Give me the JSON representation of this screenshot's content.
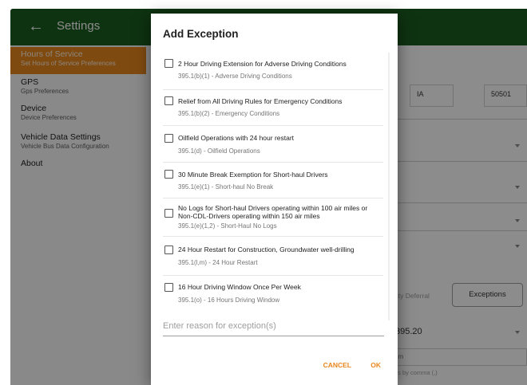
{
  "appbar": {
    "back_icon": "arrow-left-icon",
    "title": "Settings"
  },
  "sidebar": {
    "items": [
      {
        "title": "Hours of Service",
        "subtitle": "Set Hours of Service Preferences",
        "active": true
      },
      {
        "title": "GPS",
        "subtitle": "Gps Preferences",
        "active": false
      },
      {
        "title": "Device",
        "subtitle": "Device Preferences",
        "active": false
      },
      {
        "title": "Vehicle Data Settings",
        "subtitle": "Vehicle Bus Data Configuration",
        "active": false
      },
      {
        "title": "About",
        "subtitle": "",
        "active": false
      }
    ]
  },
  "main": {
    "state": "IA",
    "zip": "50501",
    "deferral_label": "uty Deferral",
    "exceptions_button": "Exceptions",
    "rule_value": "395.20",
    "rule_field_partial": "om",
    "hint_partial": "es by comma (,)"
  },
  "dialog": {
    "title": "Add Exception",
    "exceptions": [
      {
        "title": "2 Hour Driving Extension for Adverse Driving Conditions",
        "code": "395.1(b)(1) - Adverse Driving Conditions",
        "checked": false
      },
      {
        "title": "Relief from All Driving Rules for Emergency Conditions",
        "code": "395.1(b)(2) - Emergency Conditions",
        "checked": false
      },
      {
        "title": "Oilfield Operations with 24 hour restart",
        "code": "395.1(d) - Oilfield Operations",
        "checked": false
      },
      {
        "title": "30 Minute Break Exemption for Short-haul Drivers",
        "code": "395.1(e)(1) - Short-haul No Break",
        "checked": false
      },
      {
        "title": "No Logs for Short-haul Drivers operating within 100 air miles or Non-CDL-Drivers operating within 150 air miles",
        "code": "395.1(e)(1,2) - Short-Haul No Logs",
        "checked": false
      },
      {
        "title": "24 Hour Restart for Construction, Groundwater well-drilling",
        "code": "395.1(l,m) - 24 Hour Restart",
        "checked": false
      },
      {
        "title": "16 Hour Driving Window Once Per Week",
        "code": "395.1(o) - 16 Hours Driving Window",
        "checked": false
      }
    ],
    "reason": {
      "placeholder": "Enter reason for exception(s)",
      "value": ""
    },
    "cancel_label": "CANCEL",
    "ok_label": "OK"
  },
  "colors": {
    "appbar": "#1b5e20",
    "accent": "#e8871e",
    "scrim": "rgba(0,0,0,0.45)"
  }
}
